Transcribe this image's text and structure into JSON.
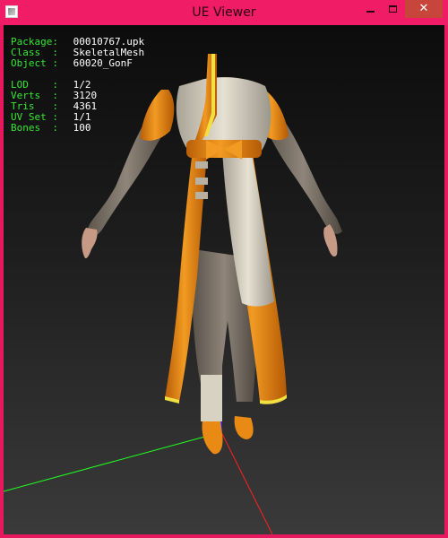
{
  "window": {
    "title": "UE Viewer",
    "icon": "app-icon",
    "buttons": {
      "minimize_icon": "minimize-icon",
      "maximize_icon": "maximize-icon",
      "close_glyph": "✕"
    },
    "border_color": "#f01c66",
    "close_color": "#c7453b"
  },
  "info": {
    "package": {
      "label": "Package:",
      "value": "00010767.upk"
    },
    "class": {
      "label": "Class  :",
      "value": "SkeletalMesh"
    },
    "object": {
      "label": "Object :",
      "value": "60020_GonF"
    },
    "lod": {
      "label": "LOD    :",
      "value": "1/2"
    },
    "verts": {
      "label": "Verts  :",
      "value": "3120"
    },
    "tris": {
      "label": "Tris   :",
      "value": "4361"
    },
    "uvset": {
      "label": "UV Set :",
      "value": "1/1"
    },
    "bones": {
      "label": "Bones  :",
      "value": "100"
    },
    "label_color": "#34e834",
    "value_color": "#ffffff"
  },
  "viewport": {
    "axes": {
      "x_color": "#ff2020",
      "y_color": "#20ff20",
      "z_color": "#2020ff"
    },
    "mesh_colors": {
      "primary": "#e88a14",
      "secondary": "#d8d2c2",
      "limbs": "#7d7468",
      "trim": "#f2e040"
    }
  }
}
